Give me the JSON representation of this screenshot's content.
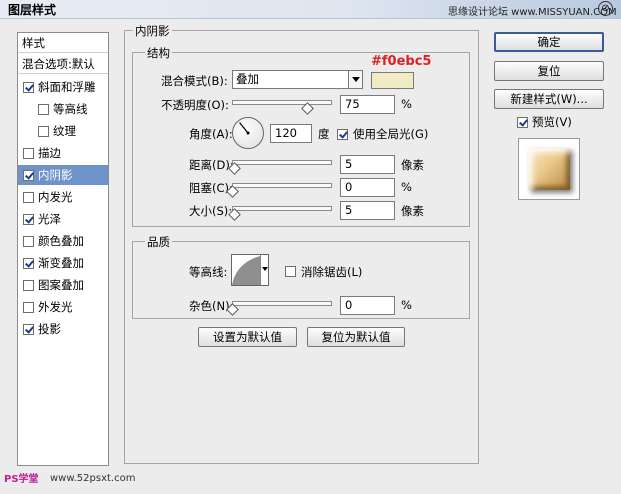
{
  "window": {
    "title": "图层样式",
    "watermark": "思缘设计论坛 www.MISSYUAN.COM",
    "close_glyph": "⊘"
  },
  "styles_list": {
    "header_styles": "样式",
    "header_blending": "混合选项:默认",
    "items": [
      {
        "label": "斜面和浮雕",
        "checked": true,
        "indent": false,
        "selected": false
      },
      {
        "label": "等高线",
        "checked": false,
        "indent": true,
        "selected": false
      },
      {
        "label": "纹理",
        "checked": false,
        "indent": true,
        "selected": false
      },
      {
        "label": "描边",
        "checked": false,
        "indent": false,
        "selected": false
      },
      {
        "label": "内阴影",
        "checked": true,
        "indent": false,
        "selected": true
      },
      {
        "label": "内发光",
        "checked": false,
        "indent": false,
        "selected": false
      },
      {
        "label": "光泽",
        "checked": true,
        "indent": false,
        "selected": false
      },
      {
        "label": "颜色叠加",
        "checked": false,
        "indent": false,
        "selected": false
      },
      {
        "label": "渐变叠加",
        "checked": true,
        "indent": false,
        "selected": false
      },
      {
        "label": "图案叠加",
        "checked": false,
        "indent": false,
        "selected": false
      },
      {
        "label": "外发光",
        "checked": false,
        "indent": false,
        "selected": false
      },
      {
        "label": "投影",
        "checked": true,
        "indent": false,
        "selected": false
      }
    ]
  },
  "inner_shadow": {
    "title": "内阴影",
    "structure": {
      "title": "结构",
      "blend_mode_label": "混合模式(B):",
      "blend_mode_value": "叠加",
      "color_annotation": "#f0ebc5",
      "color": "#f0ebc5",
      "opacity_label": "不透明度(O):",
      "opacity_value": "75",
      "opacity_unit": "%",
      "angle_label": "角度(A):",
      "angle_value": "120",
      "angle_unit": "度",
      "global_light_label": "使用全局光(G)",
      "global_light_checked": true,
      "distance_label": "距离(D):",
      "distance_value": "5",
      "distance_unit": "像素",
      "choke_label": "阻塞(C):",
      "choke_value": "0",
      "choke_unit": "%",
      "size_label": "大小(S):",
      "size_value": "5",
      "size_unit": "像素"
    },
    "quality": {
      "title": "品质",
      "contour_label": "等高线:",
      "antialias_label": "消除锯齿(L)",
      "antialias_checked": false,
      "noise_label": "杂色(N):",
      "noise_value": "0",
      "noise_unit": "%"
    },
    "make_default_button": "设置为默认值",
    "reset_default_button": "复位为默认值"
  },
  "sliders": {
    "opacity": 0.75,
    "distance": 0.02,
    "choke": 0.0,
    "size": 0.02,
    "noise": 0.0
  },
  "buttons": {
    "ok": "确定",
    "reset": "复位",
    "new_style": "新建样式(W)...",
    "preview_label": "预览(V)",
    "preview_checked": true
  },
  "footer": {
    "left_text": "PS学堂",
    "site": "www.52psxt.com"
  }
}
